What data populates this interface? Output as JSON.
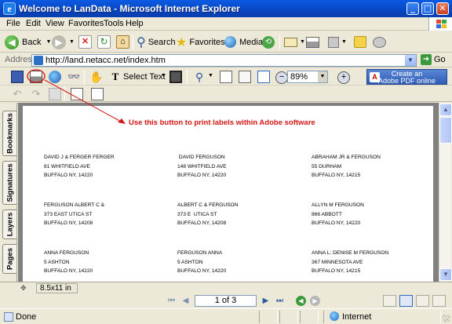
{
  "window": {
    "title": "Welcome to LanData - Microsoft Internet Explorer",
    "minimize": "_",
    "maximize": "□",
    "close": "✕"
  },
  "menu": [
    "File",
    "Edit",
    "View",
    "Favorites",
    "Tools",
    "Help"
  ],
  "ie_toolbar": {
    "back": "Back",
    "search": "Search",
    "favorites": "Favorites",
    "media": "Media"
  },
  "address": {
    "label": "Address",
    "url": "http://land.netacc.net/index.htm",
    "go": "Go"
  },
  "acrobat_toolbar": {
    "select_text": "Select Text",
    "zoom": "89%",
    "convert_line1": "Create an",
    "convert_line2": "Adobe PDF online"
  },
  "nav_tabs": [
    "Bookmarks",
    "Signatures",
    "Layers",
    "Pages"
  ],
  "annotation": "Use this button to print labels within Adobe software",
  "labels": [
    {
      "lines": [
        "DAVID J & FERGER FERGER",
        "81 WHITFIELD AVE",
        "BUFFALO  NY, 14220"
      ]
    },
    {
      "lines": [
        " DAVID FERGUSON",
        "148 WHITFIELD AVE",
        "BUFFALO  NY, 14220"
      ]
    },
    {
      "lines": [
        "ABRAHAM JR & FERGUSON",
        "55 DURHAM",
        "BUFFALO  NY, 14215"
      ]
    },
    {
      "lines": [
        "FERGUSON ALBERT C &",
        "373 EAST UTICA ST",
        "BUFFALO  NY, 14208"
      ]
    },
    {
      "lines": [
        "ALBERT C & FERGUSON",
        "373 E  UTICA ST",
        "BUFFALO  NY, 14208"
      ]
    },
    {
      "lines": [
        "ALLYN M FERGUSON",
        "866 ABBOTT",
        "BUFFALO  NY, 14220"
      ]
    },
    {
      "lines": [
        "ANNA FERGUSON",
        "5 ASHTON",
        "BUFFALO  NY, 14220"
      ]
    },
    {
      "lines": [
        "FERGUSON ANNA",
        "5 ASHTON",
        "BUFFALO  NY, 14220"
      ]
    },
    {
      "lines": [
        "ANNA L; DENISE M FERGUSON",
        "367 MINNESOTA AVE",
        "BUFFALO  NY, 14215"
      ]
    }
  ],
  "acrobat_status": {
    "page_size": "8.5x11 in",
    "page_indicator": "1 of 3"
  },
  "status": {
    "text": "Done",
    "zone": "Internet"
  },
  "colors": {
    "annotation": "#d41515",
    "titlebar": "#0a5be3"
  }
}
